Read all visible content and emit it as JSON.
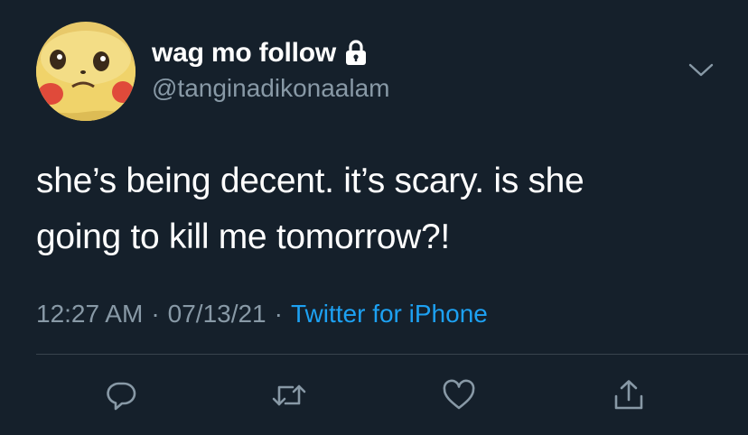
{
  "tweet": {
    "author": {
      "display_name": "wag mo follow",
      "handle": "@tanginadikonaalam",
      "protected_icon": "lock-icon",
      "avatar": "pikachu-avatar"
    },
    "text_lines": [
      "she’s being decent. it’s scary. is she",
      "going to kill me tomorrow?!"
    ],
    "meta": {
      "time": "12:27 AM",
      "separator": "·",
      "date": "07/13/21",
      "source": "Twitter for iPhone"
    },
    "menu_icon": "chevron-down-icon",
    "actions": [
      {
        "name": "reply",
        "icon": "reply-icon"
      },
      {
        "name": "retweet",
        "icon": "retweet-icon"
      },
      {
        "name": "like",
        "icon": "heart-icon"
      },
      {
        "name": "share",
        "icon": "share-icon"
      }
    ]
  },
  "colors": {
    "background": "#15202b",
    "primary_text": "#ffffff",
    "secondary_text": "#8899a6",
    "link": "#1da1f2",
    "divider": "#38444d"
  }
}
